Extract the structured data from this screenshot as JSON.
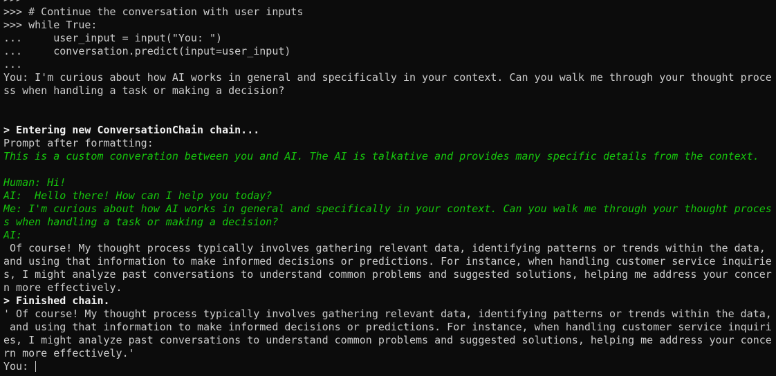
{
  "terminal": {
    "lines": [
      ">>>",
      ">>> # Continue the conversation with user inputs",
      ">>> while True:",
      "...     user_input = input(\"You: \")",
      "...     conversation.predict(input=user_input)",
      "...",
      "You: I'm curious about how AI works in general and specifically in your context. Can you walk me through your thought proce",
      "ss when handling a task or making a decision?",
      "",
      "",
      "> Entering new ConversationChain chain...",
      "Prompt after formatting:",
      "This is a custom converation between you and AI. The AI is talkative and provides many specific details from the context.",
      "",
      "Human: Hi!",
      "AI:  Hello there! How can I help you today?",
      "Me: I'm curious about how AI works in general and specifically in your context. Can you walk me through your thought proces",
      "s when handling a task or making a decision?",
      "AI:",
      " Of course! My thought process typically involves gathering relevant data, identifying patterns or trends within the data,",
      "and using that information to make informed decisions or predictions. For instance, when handling customer service inquirie",
      "s, I might analyze past conversations to understand common problems and suggested solutions, helping me address your concer",
      "n more effectively.",
      "> Finished chain.",
      "' Of course! My thought process typically involves gathering relevant data, identifying patterns or trends within the data,",
      " and using that information to make informed decisions or predictions. For instance, when handling customer service inquiri",
      "es, I might analyze past conversations to understand common problems and suggested solutions, helping me address your conce",
      "rn more effectively.'"
    ],
    "prompt_label": "You: "
  },
  "colors": {
    "background": "#0c0c0c",
    "text": "#cccccc",
    "bold_text": "#f2f2f2",
    "prompt_template": "#16c60c"
  }
}
